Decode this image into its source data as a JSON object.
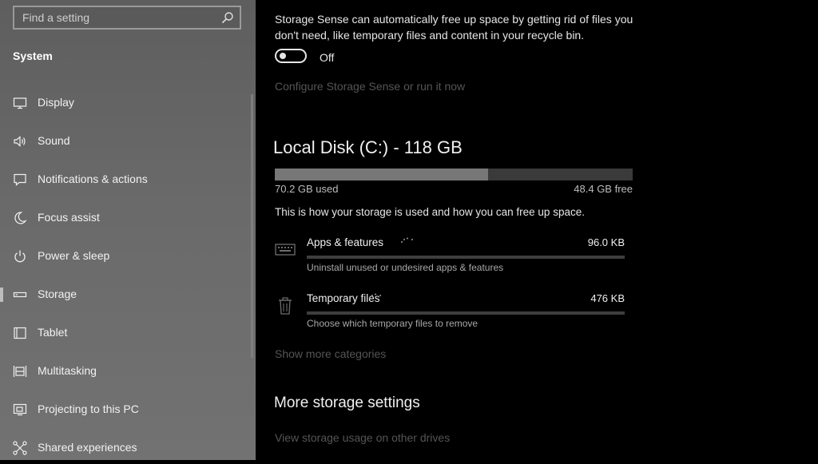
{
  "search": {
    "placeholder": "Find a setting"
  },
  "sidebar": {
    "section": "System",
    "items": [
      {
        "label": "Display",
        "icon": "monitor-icon"
      },
      {
        "label": "Sound",
        "icon": "speaker-icon"
      },
      {
        "label": "Notifications & actions",
        "icon": "message-icon"
      },
      {
        "label": "Focus assist",
        "icon": "moon-icon"
      },
      {
        "label": "Power & sleep",
        "icon": "power-icon"
      },
      {
        "label": "Storage",
        "icon": "storage-drive-icon",
        "selected": true
      },
      {
        "label": "Tablet",
        "icon": "tablet-icon"
      },
      {
        "label": "Multitasking",
        "icon": "multitasking-icon"
      },
      {
        "label": "Projecting to this PC",
        "icon": "projecting-icon"
      },
      {
        "label": "Shared experiences",
        "icon": "shared-experiences-icon"
      }
    ]
  },
  "storage_sense": {
    "description": "Storage Sense can automatically free up space by getting rid of files you don't need, like temporary files and content in your recycle bin.",
    "toggle_state": "Off",
    "configure_link": "Configure Storage Sense or run it now"
  },
  "disk": {
    "title": "Local Disk (C:) - 118 GB",
    "used": "70.2 GB used",
    "free": "48.4 GB free",
    "used_fraction": 0.595,
    "info": "This is how your storage is used and how you can free up space."
  },
  "categories": [
    {
      "name": "Apps & features",
      "size": "96.0 KB",
      "subtitle": "Uninstall unused or undesired apps & features",
      "icon": "keyboard-icon",
      "fill": 0.0
    },
    {
      "name": "Temporary files",
      "size": "476 KB",
      "subtitle": "Choose which temporary files to remove",
      "icon": "trash-icon",
      "fill": 0.0
    }
  ],
  "show_more": "Show more categories",
  "more_storage": {
    "title": "More storage settings",
    "link": "View storage usage on other drives"
  }
}
